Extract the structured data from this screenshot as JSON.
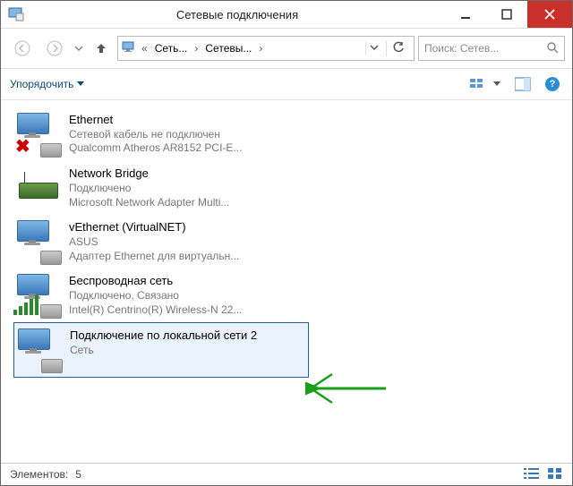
{
  "titlebar": {
    "title": "Сетевые подключения"
  },
  "nav": {
    "crumb1": "Сеть...",
    "crumb2": "Сетевы...",
    "search_placeholder": "Поиск: Сетев..."
  },
  "toolbar": {
    "organize": "Упорядочить"
  },
  "connections": [
    {
      "name": "Ethernet",
      "status": "Сетевой кабель не подключен",
      "device": "Qualcomm Atheros AR8152 PCI-E...",
      "icon": "ethernet-disconnected",
      "selected": false
    },
    {
      "name": "Network Bridge",
      "status": "Подключено",
      "device": "Microsoft Network Adapter Multi...",
      "icon": "bridge",
      "selected": false
    },
    {
      "name": "vEthernet (VirtualNET)",
      "status": "ASUS",
      "device": "Адаптер Ethernet для виртуальн...",
      "icon": "ethernet",
      "selected": false
    },
    {
      "name": "Беспроводная сеть",
      "status": "Подключено, Связано",
      "device": "Intel(R) Centrino(R) Wireless-N 22...",
      "icon": "wifi",
      "selected": false
    },
    {
      "name": "Подключение по локальной сети 2",
      "status": "",
      "device": "Сеть",
      "icon": "ethernet",
      "selected": true
    }
  ],
  "statusbar": {
    "label": "Элементов:",
    "count": "5"
  }
}
